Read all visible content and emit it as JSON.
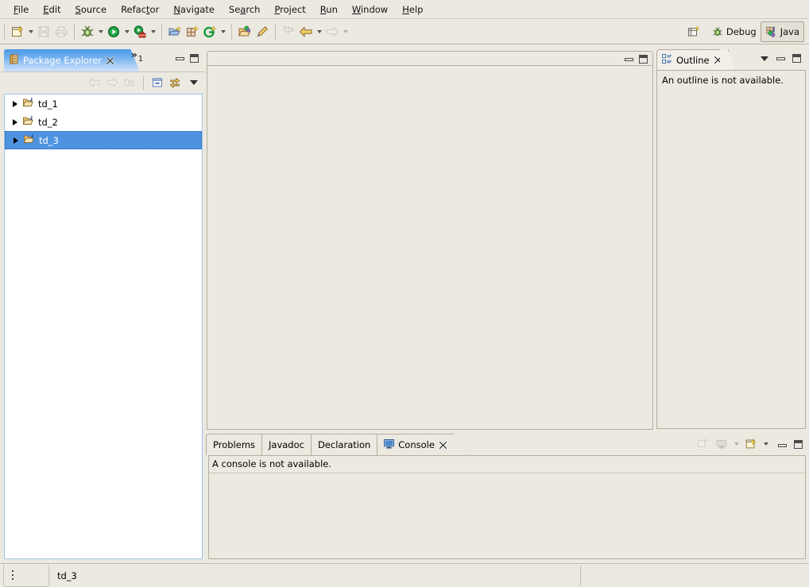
{
  "menu": {
    "items": [
      {
        "label": "File",
        "mnemonic": "F"
      },
      {
        "label": "Edit",
        "mnemonic": "E"
      },
      {
        "label": "Source",
        "mnemonic": "S"
      },
      {
        "label": "Refactor",
        "mnemonic": "t"
      },
      {
        "label": "Navigate",
        "mnemonic": "N"
      },
      {
        "label": "Search",
        "mnemonic": "a"
      },
      {
        "label": "Project",
        "mnemonic": "P"
      },
      {
        "label": "Run",
        "mnemonic": "R"
      },
      {
        "label": "Window",
        "mnemonic": "W"
      },
      {
        "label": "Help",
        "mnemonic": "H"
      }
    ]
  },
  "toolbar": {
    "buttons": [
      {
        "name": "new-wizard-icon",
        "title": "New",
        "enabled": true,
        "dropdown": true
      },
      {
        "name": "save-icon",
        "title": "Save",
        "enabled": false,
        "dropdown": false
      },
      {
        "name": "print-icon",
        "title": "Print",
        "enabled": false,
        "dropdown": false
      },
      {
        "name": "debug-icon",
        "title": "Debug",
        "enabled": true,
        "dropdown": true
      },
      {
        "name": "run-icon",
        "title": "Run",
        "enabled": true,
        "dropdown": true
      },
      {
        "name": "external-tools-icon",
        "title": "External Tools",
        "enabled": true,
        "dropdown": true
      },
      {
        "name": "new-java-project-icon",
        "title": "New Java Project",
        "enabled": true,
        "dropdown": false
      },
      {
        "name": "new-package-icon",
        "title": "New Java Package",
        "enabled": true,
        "dropdown": false
      },
      {
        "name": "new-class-icon",
        "title": "New Java Class",
        "enabled": true,
        "dropdown": true
      },
      {
        "name": "open-type-icon",
        "title": "Open Type",
        "enabled": true,
        "dropdown": false
      },
      {
        "name": "search-pencil-icon",
        "title": "Search",
        "enabled": true,
        "dropdown": false
      },
      {
        "name": "last-edit-location-icon",
        "title": "Last Edit Location",
        "enabled": false,
        "dropdown": false
      },
      {
        "name": "back-icon",
        "title": "Back",
        "enabled": true,
        "dropdown": true
      },
      {
        "name": "forward-icon",
        "title": "Forward",
        "enabled": false,
        "dropdown": true
      }
    ],
    "perspective": {
      "open_perspective_label": "",
      "debug_label": "Debug",
      "java_label": "Java"
    }
  },
  "package_explorer": {
    "tab_title": "Package Explorer",
    "hidden_tabs_chevron": "»",
    "hidden_tabs_count": "1",
    "toolbar_buttons": [
      {
        "name": "back-icon",
        "enabled": false
      },
      {
        "name": "forward-icon",
        "enabled": false
      },
      {
        "name": "up-icon",
        "enabled": false
      },
      {
        "name": "collapse-all-icon",
        "enabled": true
      },
      {
        "name": "link-with-editor-icon",
        "enabled": true
      },
      {
        "name": "view-menu-icon",
        "enabled": true
      }
    ],
    "tree": [
      {
        "label": "td_1",
        "icon": "java-project-icon",
        "selected": false,
        "expandable": true
      },
      {
        "label": "td_2",
        "icon": "java-project-icon",
        "selected": false,
        "expandable": true
      },
      {
        "label": "td_3",
        "icon": "java-project-icon",
        "selected": true,
        "expandable": true
      }
    ]
  },
  "editor": {
    "tabs": [],
    "content": ""
  },
  "outline": {
    "tab_title": "Outline",
    "message": "An outline is not available."
  },
  "bottom_panel": {
    "tabs": [
      {
        "label": "Problems",
        "active": false,
        "icon": null
      },
      {
        "label": "Javadoc",
        "active": false,
        "icon": null
      },
      {
        "label": "Declaration",
        "active": false,
        "icon": null
      },
      {
        "label": "Console",
        "active": true,
        "icon": "console-icon"
      }
    ],
    "message": "A console is not available.",
    "toolbar_buttons": [
      {
        "name": "pin-console-icon",
        "enabled": false,
        "dropdown": false
      },
      {
        "name": "display-selected-console-icon",
        "enabled": false,
        "dropdown": true
      },
      {
        "name": "open-console-icon",
        "enabled": true,
        "dropdown": true
      }
    ]
  },
  "statusbar": {
    "text": "td_3"
  },
  "colors": {
    "window_bg": "#ece9e1",
    "active_tab_blue": "#4b98e8",
    "selection_blue": "#4f93e0",
    "tree_bg": "#ffffff",
    "border": "#b5ae9d"
  }
}
